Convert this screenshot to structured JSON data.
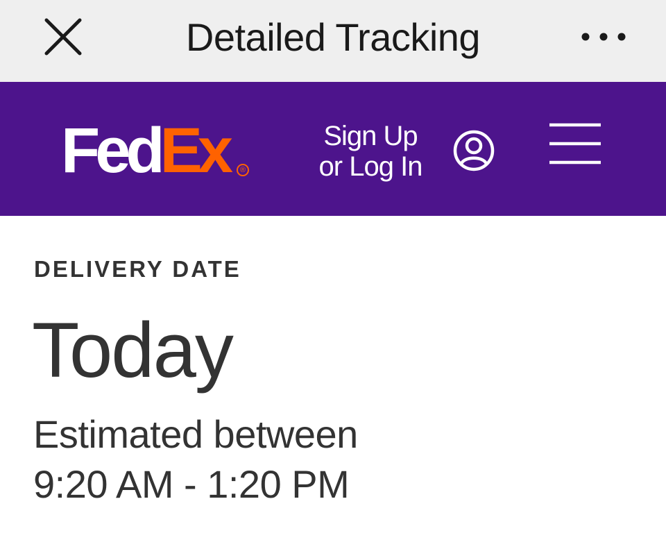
{
  "nav_bar": {
    "title": "Detailed Tracking",
    "close_icon": "close-icon",
    "more_icon": "more-options-icon"
  },
  "header": {
    "logo": {
      "part1": "Fed",
      "part2": "Ex",
      "registered": "®",
      "colors": {
        "fed": "#ffffff",
        "ex": "#ff6200"
      }
    },
    "sign_in_line1": "Sign Up",
    "sign_in_line2": "or Log In",
    "user_icon": "user-account-icon",
    "menu_icon": "hamburger-menu-icon",
    "background": "#4d148c"
  },
  "delivery": {
    "label": "DELIVERY DATE",
    "day": "Today",
    "estimate_line1": "Estimated between",
    "estimate_line2": "9:20 AM - 1:20 PM"
  }
}
